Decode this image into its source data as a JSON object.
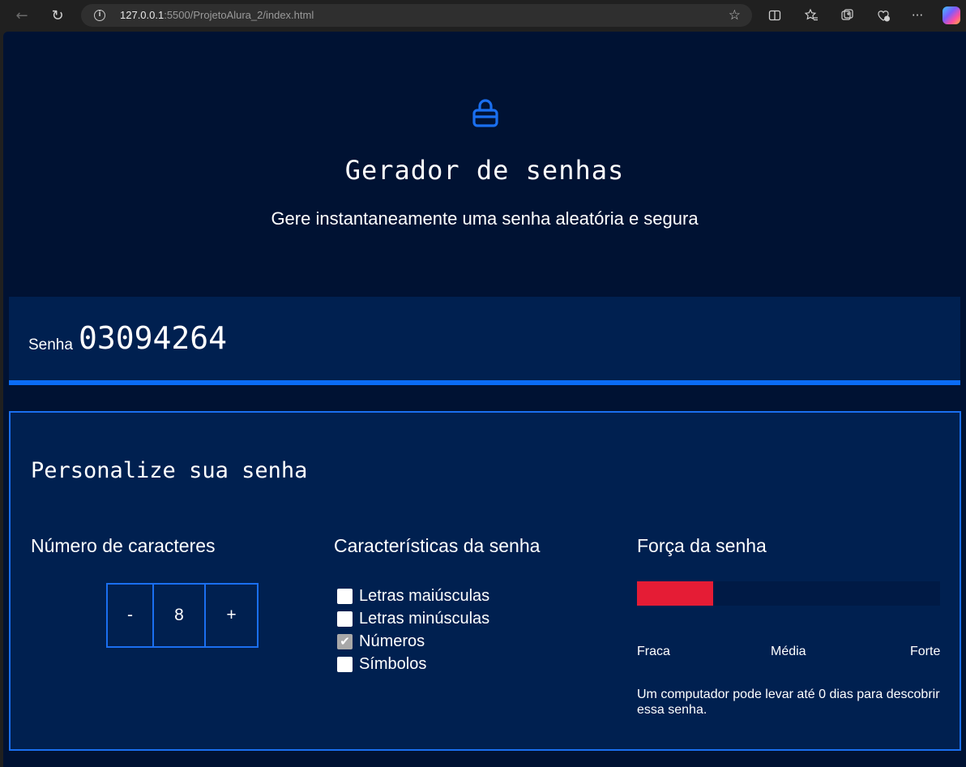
{
  "browser": {
    "url_host": "127.0.0.1",
    "url_rest": ":5500/ProjetoAlura_2/index.html"
  },
  "header": {
    "icon": "lock-icon",
    "title": "Gerador de senhas",
    "subtitle": "Gere instantaneamente uma senha aleatória e segura"
  },
  "password": {
    "label": "Senha",
    "value": "03094264"
  },
  "customize": {
    "title": "Personalize sua senha",
    "length": {
      "heading": "Número de caracteres",
      "minus": "-",
      "value": "8",
      "plus": "+"
    },
    "features": {
      "heading": "Características da senha",
      "options": [
        {
          "label": "Letras maiúsculas",
          "checked": false
        },
        {
          "label": "Letras minúsculas",
          "checked": false
        },
        {
          "label": "Números",
          "checked": true
        },
        {
          "label": "Símbolos",
          "checked": false
        }
      ]
    },
    "strength": {
      "heading": "Força da senha",
      "level": 0.25,
      "fill_color": "#e51c35",
      "labels": [
        "Fraca",
        "Média",
        "Forte"
      ],
      "message": "Um computador pode levar até 0 dias para descobrir essa senha."
    }
  },
  "colors": {
    "page_bg": "#001233",
    "panel_bg": "#002050",
    "accent": "#1a6ff0"
  }
}
